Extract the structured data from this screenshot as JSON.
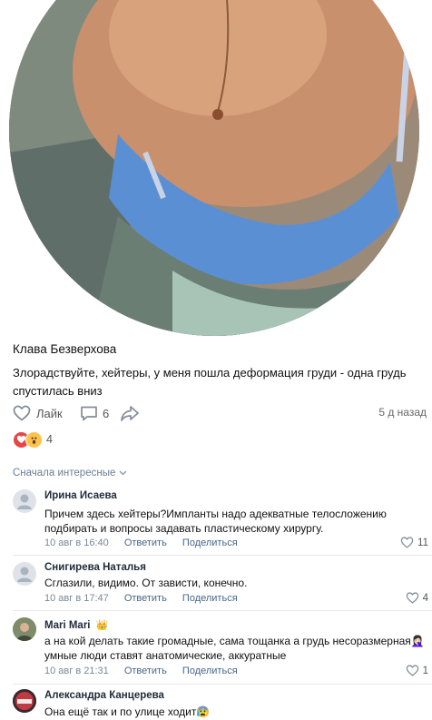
{
  "post": {
    "author": "Клава Безверхова",
    "text": "Злорадствуйте, хейтеры, у меня пошла деформация груди - одна грудь спустилась вниз",
    "like_label": "Лайк",
    "comments_count": "6",
    "time": "5 д назад",
    "reactions_count": "4",
    "colors": {
      "heart": "#e64646",
      "wow": "#ffc24b",
      "muted": "#828a99"
    }
  },
  "comments_section": {
    "sort_label": "Сначала интересные"
  },
  "comments": [
    {
      "name": "Ирина Исаева",
      "text": "Причем здесь хейтеры?Импланты надо адекватные телосложению подбирать и вопросы задавать пластическому хирургу.",
      "date": "10 авг в 16:40",
      "reply": "Ответить",
      "share": "Поделиться",
      "likes": "11"
    },
    {
      "name": "Снигирева Наталья",
      "text": "Сглазили, видимо. От зависти, конечно.",
      "date": "10 авг в 17:47",
      "reply": "Ответить",
      "share": "Поделиться",
      "likes": "4"
    },
    {
      "name": "Mari Mari",
      "badge": "👑",
      "text": "а на кой делать такие громадные, сама тощанка а грудь несоразмерная🤦🏻‍♀️ умные люди ставят анатомические, аккуратные",
      "date": "10 авг в 21:31",
      "reply": "Ответить",
      "share": "Поделиться",
      "likes": "1"
    },
    {
      "name": "Александра Канцерева",
      "text": "Она ещё так и по улице ходит😰"
    }
  ]
}
